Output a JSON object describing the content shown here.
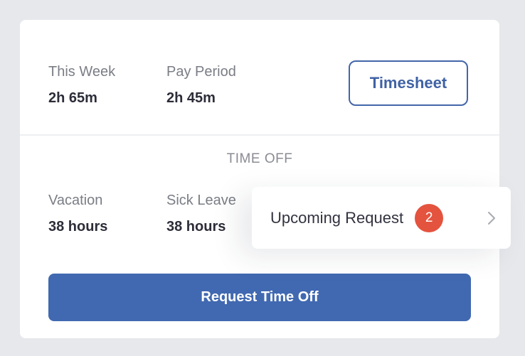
{
  "summary": {
    "this_week": {
      "label": "This Week",
      "value": "2h 65m"
    },
    "pay_period": {
      "label": "Pay Period",
      "value": "2h 45m"
    },
    "timesheet_button": "Timesheet"
  },
  "time_off": {
    "title": "TIME OFF",
    "vacation": {
      "label": "Vacation",
      "value": "38 hours"
    },
    "sick_leave": {
      "label": "Sick Leave",
      "value": "38 hours"
    },
    "request_button": "Request Time Off"
  },
  "upcoming": {
    "label": "Upcoming Request",
    "count": "2",
    "icon": "chevron-right-icon"
  },
  "colors": {
    "primary": "#4169b1",
    "badge": "#e4533e",
    "background": "#e6e8ec"
  }
}
